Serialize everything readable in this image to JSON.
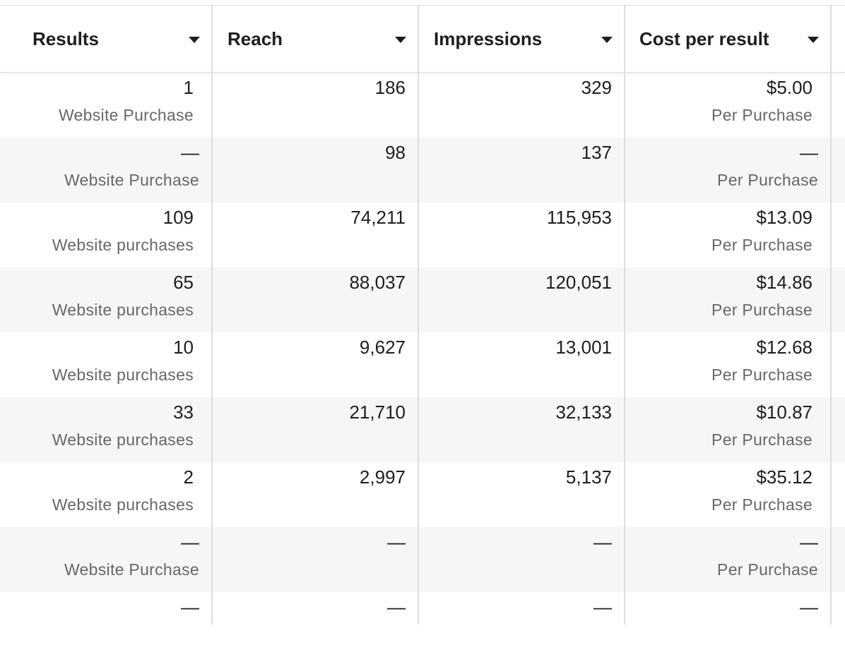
{
  "columns": [
    {
      "label": "Results"
    },
    {
      "label": "Reach"
    },
    {
      "label": "Impressions"
    },
    {
      "label": "Cost per result"
    }
  ],
  "rows": [
    {
      "results": "1",
      "results_sub": "Website Purchase",
      "reach": "186",
      "impressions": "329",
      "cost": "$5.00",
      "cost_sub": "Per Purchase",
      "alt": false,
      "dash": false
    },
    {
      "results": "—",
      "results_sub": "Website Purchase",
      "reach": "98",
      "impressions": "137",
      "cost": "—",
      "cost_sub": "Per Purchase",
      "alt": true,
      "dash": true
    },
    {
      "results": "109",
      "results_sub": "Website purchases",
      "reach": "74,211",
      "impressions": "115,953",
      "cost": "$13.09",
      "cost_sub": "Per Purchase",
      "alt": false,
      "dash": false
    },
    {
      "results": "65",
      "results_sub": "Website purchases",
      "reach": "88,037",
      "impressions": "120,051",
      "cost": "$14.86",
      "cost_sub": "Per Purchase",
      "alt": true,
      "dash": false
    },
    {
      "results": "10",
      "results_sub": "Website purchases",
      "reach": "9,627",
      "impressions": "13,001",
      "cost": "$12.68",
      "cost_sub": "Per Purchase",
      "alt": false,
      "dash": false
    },
    {
      "results": "33",
      "results_sub": "Website purchases",
      "reach": "21,710",
      "impressions": "32,133",
      "cost": "$10.87",
      "cost_sub": "Per Purchase",
      "alt": true,
      "dash": false
    },
    {
      "results": "2",
      "results_sub": "Website purchases",
      "reach": "2,997",
      "impressions": "5,137",
      "cost": "$35.12",
      "cost_sub": "Per Purchase",
      "alt": false,
      "dash": false
    },
    {
      "results": "—",
      "results_sub": "Website Purchase",
      "reach": "—",
      "impressions": "—",
      "cost": "—",
      "cost_sub": "Per Purchase",
      "alt": true,
      "dash": true
    },
    {
      "results": "—",
      "results_sub": "",
      "reach": "—",
      "impressions": "—",
      "cost": "—",
      "cost_sub": "",
      "alt": false,
      "dash": true
    }
  ]
}
